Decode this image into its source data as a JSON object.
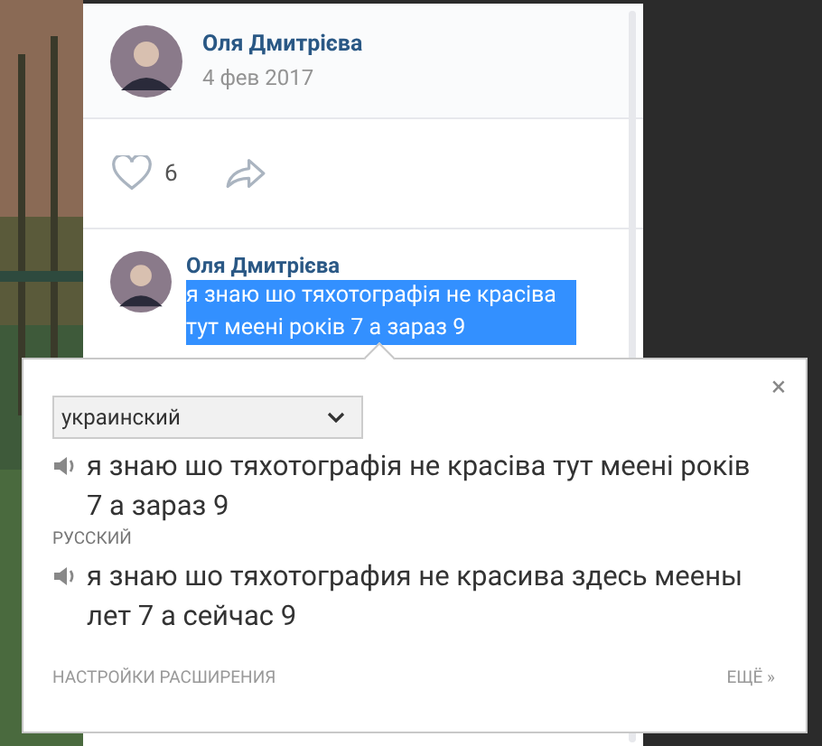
{
  "post": {
    "author": "Оля Дмитрієва",
    "date": "4 фев 2017",
    "likes": "6",
    "liked": false
  },
  "comment": {
    "author": "Оля Дмитрієва",
    "text": "я знаю шо тяхотографія не красіва тут меені років 7 а зараз 9",
    "selected": true
  },
  "translate_popup": {
    "source_language": "украинский",
    "source_text": "я знаю шо тяхотографія не красіва тут меені років 7 а зараз 9",
    "target_language": "РУССКИЙ",
    "target_text": "я знаю шо тяхотография не красива здесь меены лет 7 а сейчас 9",
    "settings_link": "НАСТРОЙКИ РАСШИРЕНИЯ",
    "more_link": "ЕЩЁ »",
    "close": "×"
  }
}
